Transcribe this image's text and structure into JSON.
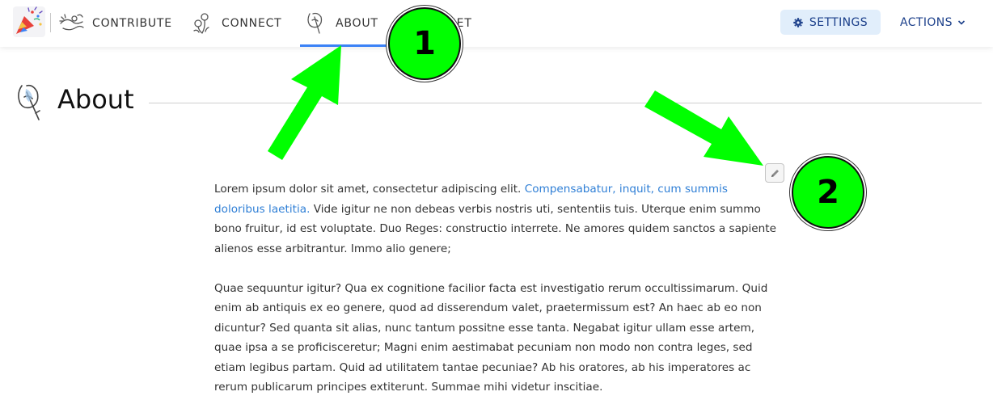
{
  "nav": {
    "items": [
      {
        "label": "CONTRIBUTE",
        "icon": "hands-icon"
      },
      {
        "label": "CONNECT",
        "icon": "flowers-icon"
      },
      {
        "label": "ABOUT",
        "icon": "hand-pen-icon",
        "active": true
      },
      {
        "label": "BUDGET",
        "icon": "budget-icon"
      }
    ],
    "settings_label": "SETTINGS",
    "actions_label": "ACTIONS"
  },
  "page": {
    "title": "About"
  },
  "content": {
    "p1_before_link": "Lorem ipsum dolor sit amet, consectetur adipiscing elit. ",
    "p1_link": "Compensabatur, inquit, cum summis doloribus laetitia.",
    "p1_after_link": " Vide igitur ne non debeas verbis nostris uti, sententiis tuis. Uterque enim summo bono fruitur, id est voluptate. Duo Reges: constructio interrete. Ne amores quidem sanctos a sapiente alienos esse arbitrantur. Immo alio genere;",
    "p2": "Quae sequuntur igitur? Qua ex cognitione facilior facta est investigatio rerum occultissimarum. Quid enim ab antiquis ex eo genere, quod ad disserendum valet, praetermissum est? An haec ab eo non dicuntur? Sed quanta sit alias, nunc tantum possitne esse tanta. Negabat igitur ullam esse artem, quae ipsa a se proficisceretur; Magni enim aestimabat pecuniam non modo non contra leges, sed etiam legibus partam. Quid ad utilitatem tantae pecuniae? Ab his oratores, ab his imperatores ac rerum publicarum principes extiterunt. Summae mihi videtur inscitiae."
  },
  "annotations": {
    "marker1": "1",
    "marker2": "2",
    "color": "#00ff00"
  },
  "colors": {
    "accent": "#3b82f6",
    "link": "#2f7fd6",
    "settings_bg": "#e1eefb",
    "button_text": "#1b3f8a"
  }
}
